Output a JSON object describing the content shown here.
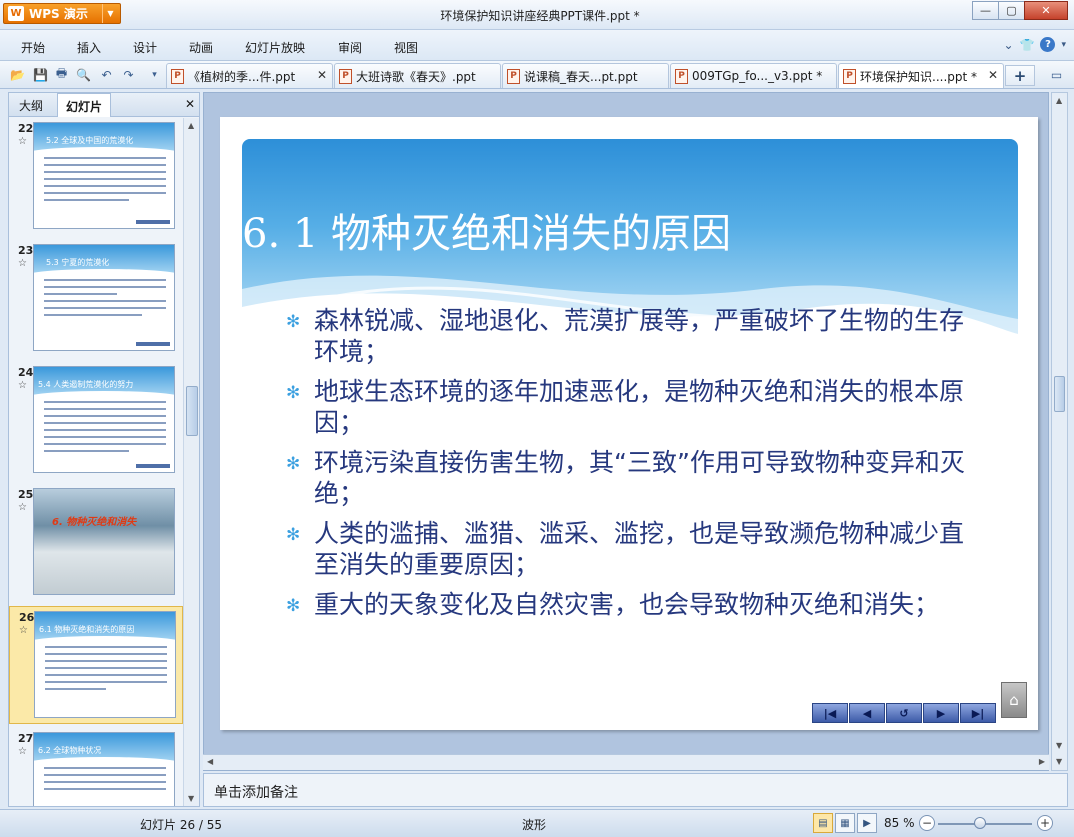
{
  "app": {
    "name": "WPS 演示",
    "logo": "W",
    "window_title": "环境保护知识讲座经典PPT课件.ppt *"
  },
  "menu": [
    "开始",
    "插入",
    "设计",
    "动画",
    "幻灯片放映",
    "审阅",
    "视图"
  ],
  "doc_tabs": [
    {
      "label": "《植树的季...件.ppt",
      "active": false
    },
    {
      "label": "大班诗歌《春天》.ppt",
      "active": false
    },
    {
      "label": "说课稿_春天...pt.ppt",
      "active": false
    },
    {
      "label": "009TGp_fo..._v3.ppt *",
      "active": false
    },
    {
      "label": "环境保护知识....ppt *",
      "active": true
    }
  ],
  "left_panel": {
    "tabs": [
      "大纲",
      "幻灯片"
    ],
    "active_tab": "幻灯片",
    "thumbnails": [
      {
        "number": "22",
        "title": "5.2 全球及中国的荒漠化",
        "style": "blue",
        "selected": false
      },
      {
        "number": "23",
        "title": "5.3 宁夏的荒漠化",
        "style": "blue",
        "selected": false
      },
      {
        "number": "24",
        "title": "5.4 人类遏制荒漠化的努力",
        "style": "blue",
        "selected": false
      },
      {
        "number": "25",
        "title": "6. 物种灭绝和消失",
        "style": "photo",
        "selected": false
      },
      {
        "number": "26",
        "title": "6.1 物种灭绝和消失的原因",
        "style": "blue",
        "selected": true
      },
      {
        "number": "27",
        "title": "6.2 全球物种状况",
        "style": "blue",
        "selected": false
      }
    ]
  },
  "slide": {
    "title": "6. 1  物种灭绝和消失的原因",
    "bullets": [
      "森林锐减、湿地退化、荒漠扩展等，严重破坏了生物的生存环境；",
      "地球生态环境的逐年加速恶化，是物种灭绝和消失的根本原因；",
      "环境污染直接伤害生物，其“三致”作用可导致物种变异和灭绝；",
      "人类的滥捕、滥猎、滥采、滥挖，也是导致濒危物种减少直至消失的重要原因；",
      "重大的天象变化及自然灾害，也会导致物种灭绝和消失；"
    ]
  },
  "notes": {
    "placeholder": "单击添加备注"
  },
  "status": {
    "slide_info": "幻灯片 26 / 55",
    "theme": "波形",
    "zoom": "85 %",
    "zoom_level": 0.45
  },
  "colors": {
    "accent": "#3a98db",
    "bullet_text": "#26387e",
    "wps_orange": "#e67100"
  }
}
